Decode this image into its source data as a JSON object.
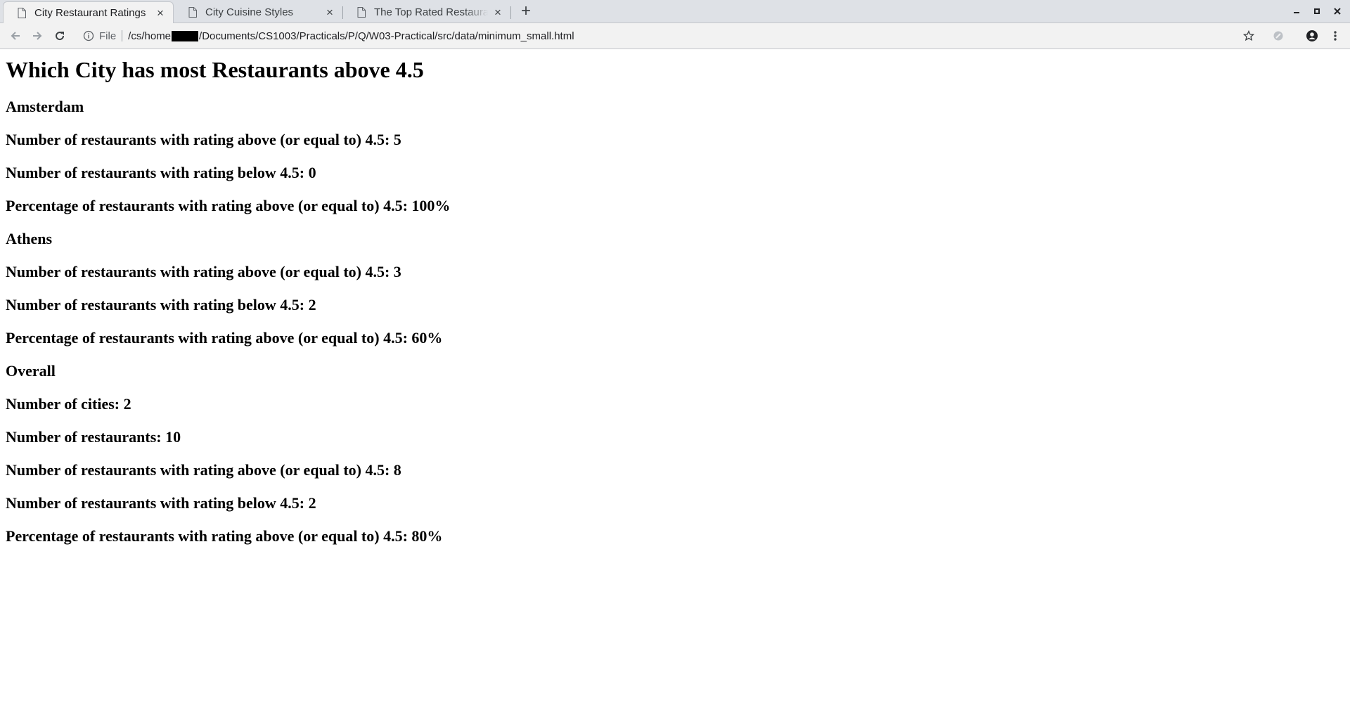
{
  "browser": {
    "tabs": [
      {
        "title": "City Restaurant Ratings",
        "active": true
      },
      {
        "title": "City Cuisine Styles",
        "active": false
      },
      {
        "title": "The Top Rated Restaurants",
        "active": false
      }
    ],
    "address_bar": {
      "scheme_label": "File",
      "url_before_redaction": "/cs/home",
      "url_after_redaction": "/Documents/CS1003/Practicals/P/Q/W03-Practical/src/data/minimum_small.html"
    }
  },
  "page": {
    "title": "Which City has most Restaurants above 4.5",
    "cities": [
      {
        "name": "Amsterdam",
        "above": "Number of restaurants with rating above (or equal to) 4.5: 5",
        "below": "Number of restaurants with rating below 4.5: 0",
        "percentage": "Percentage of restaurants with rating above (or equal to) 4.5: 100%"
      },
      {
        "name": "Athens",
        "above": "Number of restaurants with rating above (or equal to) 4.5: 3",
        "below": "Number of restaurants with rating below 4.5: 2",
        "percentage": "Percentage of restaurants with rating above (or equal to) 4.5: 60%"
      }
    ],
    "overall": {
      "heading": "Overall",
      "cities": "Number of cities: 2",
      "restaurants": "Number of restaurants: 10",
      "above": "Number of restaurants with rating above (or equal to) 4.5: 8",
      "below": "Number of restaurants with rating below 4.5: 2",
      "percentage": "Percentage of restaurants with rating above (or equal to) 4.5: 80%"
    }
  }
}
